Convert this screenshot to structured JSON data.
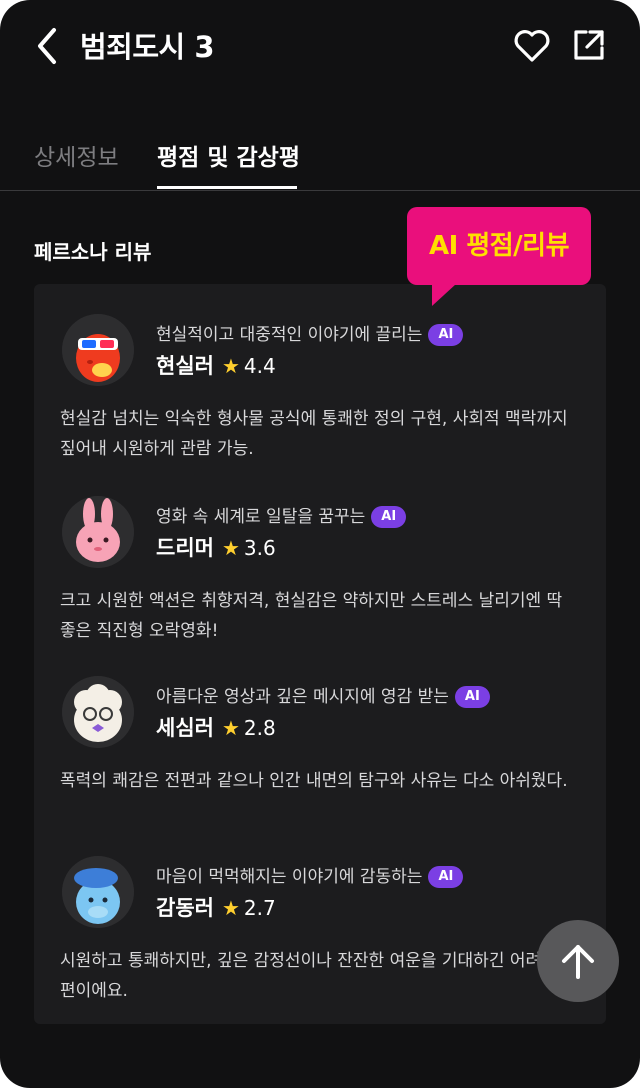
{
  "header": {
    "title": "범죄도시 3",
    "back_icon": "chevron-left-icon",
    "heart_icon": "heart-outline-icon",
    "share_icon": "share-external-icon"
  },
  "tabs": [
    {
      "label": "상세정보",
      "active": false
    },
    {
      "label": "평점 및 감상평",
      "active": true
    }
  ],
  "section": {
    "title": "페르소나 리뷰"
  },
  "tooltip": {
    "text": "AI 평점/리뷰",
    "bg_color": "#ea0f7c",
    "text_color": "#ffdf00"
  },
  "reviews": [
    {
      "avatar_icon": "red-popcorn-character-avatar",
      "tagline": "현실적이고 대중적인 이야기에 끌리는",
      "badge": "AI",
      "name": "현실러",
      "rating": "4.4",
      "text": "현실감 넘치는 익숙한 형사물 공식에 통쾌한 정의 구현, 사회적 맥락까지 짚어내 시원하게 관람 가능."
    },
    {
      "avatar_icon": "pink-bunny-character-avatar",
      "tagline": "영화 속 세계로 일탈을 꿈꾸는",
      "badge": "AI",
      "name": "드리머",
      "rating": "3.6",
      "text": "크고 시원한 액션은 취향저격, 현실감은 약하지만 스트레스 날리기엔 딱 좋은 직진형 오락영화!"
    },
    {
      "avatar_icon": "white-fluffy-glasses-character-avatar",
      "tagline": "아름다운 영상과 깊은 메시지에 영감 받는",
      "badge": "AI",
      "name": "세심러",
      "rating": "2.8",
      "text": "폭력의 쾌감은 전편과 같으나 인간 내면의 탐구와 사유는 다소 아쉬웠다."
    },
    {
      "avatar_icon": "blue-beret-character-avatar",
      "tagline": "마음이 먹먹해지는 이야기에 감동하는",
      "badge": "AI",
      "name": "감동러",
      "rating": "2.7",
      "text": "시원하고 통쾌하지만, 깊은 감정선이나 잔잔한 여운을 기대하긴 어려운 편이에요."
    }
  ],
  "scroll_top_button": {
    "icon": "arrow-up-icon"
  },
  "colors": {
    "background": "#111112",
    "card": "#1c1c1e",
    "ai_badge": "#7b3fe4",
    "star": "#ffcf2e"
  }
}
